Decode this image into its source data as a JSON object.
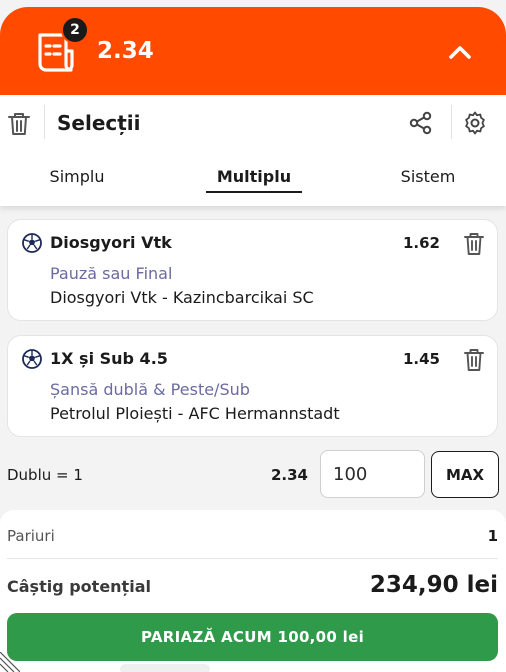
{
  "header": {
    "selection_count": "2",
    "total_odds": "2.34",
    "icons": {
      "slip": "bet-slip-icon",
      "collapse": "chevron-up-icon"
    },
    "color": "#ff4a00"
  },
  "toolbar": {
    "title": "Selecții",
    "icons": {
      "delete_all": "trash-icon",
      "share": "share-icon",
      "settings": "gear-icon"
    }
  },
  "tabs": [
    {
      "label": "Simplu",
      "active": false
    },
    {
      "label": "Multiplu",
      "active": true
    },
    {
      "label": "Sistem",
      "active": false
    }
  ],
  "selections": [
    {
      "name": "Diosgyori Vtk",
      "odds": "1.62",
      "market": "Pauză sau Final",
      "match": "Diosgyori Vtk - Kazincbarcikai SC",
      "icon": "football-icon"
    },
    {
      "name": "1X și Sub 4.5",
      "odds": "1.45",
      "market": "Șansă dublă & Peste/Sub",
      "match": "Petrolul Ploiești - AFC Hermannstadt",
      "icon": "football-icon"
    }
  ],
  "combo": {
    "label": "Dublu = 1",
    "odds": "2.34",
    "stake_value": "100",
    "max_label": "MAX"
  },
  "summary": {
    "bets_label": "Pariuri",
    "bets_value": "1",
    "win_label": "Câștig potențial",
    "win_value": "234,90 lei"
  },
  "action": {
    "place_label": "PARIAZĂ ACUM 100,00 lei",
    "color": "#2f9a4a"
  }
}
